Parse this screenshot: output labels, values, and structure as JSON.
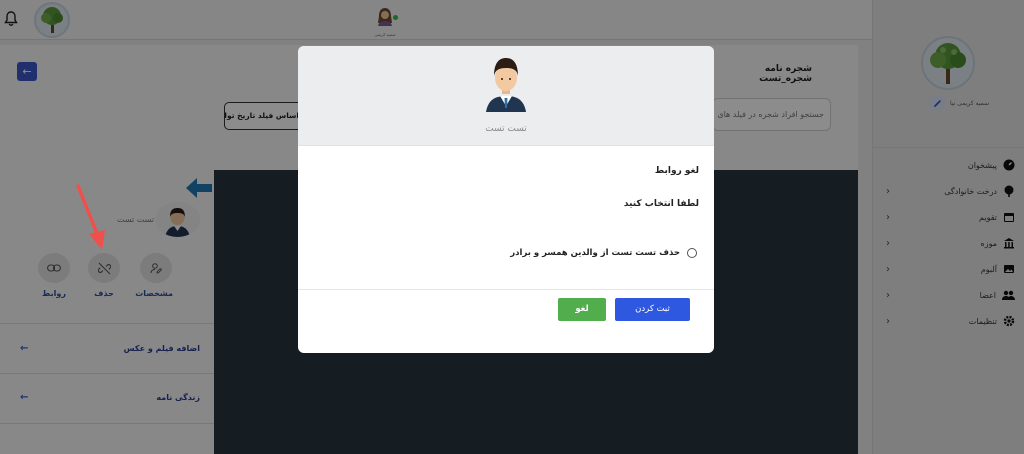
{
  "colors": {
    "accent": "#2f58e0",
    "cancel": "#52ad4c",
    "canvas": "#27353f",
    "arrow_annotation": "#f0504b"
  },
  "topbar": {
    "user_name": "صمیه کریمی"
  },
  "sidebar": {
    "user_name": "سمیه کریمی نیا",
    "items": [
      {
        "label": "پیشخوان",
        "icon": "dashboard-icon",
        "has_chevron": false
      },
      {
        "label": "درخت خانوادگی",
        "icon": "tree-icon",
        "has_chevron": true
      },
      {
        "label": "تقویم",
        "icon": "calendar-icon",
        "has_chevron": true
      },
      {
        "label": "موزه",
        "icon": "museum-icon",
        "has_chevron": true
      },
      {
        "label": "آلبوم",
        "icon": "album-icon",
        "has_chevron": true
      },
      {
        "label": "اعضا",
        "icon": "members-icon",
        "has_chevron": true
      },
      {
        "label": "تنظیمات",
        "icon": "settings-icon",
        "has_chevron": true
      }
    ]
  },
  "main": {
    "title": "شجره نامه شجره_تست",
    "search_placeholder": "جستجو افراد شجره در فیلد های",
    "filter_label": "اساس فیلد تاریخ تولد"
  },
  "node": {
    "name": "تست تست",
    "actions": [
      {
        "label": "مشخصات",
        "icon": "user-edit-icon"
      },
      {
        "label": "حذف",
        "icon": "unlink-icon"
      },
      {
        "label": "روابط",
        "icon": "link-icon"
      }
    ]
  },
  "left_panel": {
    "rows": [
      {
        "label": "اضافه فیلم و عکس"
      },
      {
        "label": "زندگی نامه"
      }
    ]
  },
  "modal": {
    "name": "تست تست",
    "title": "لغو روابط",
    "subtitle": "لطفا انتخاب کنید",
    "option": "حذف تست تست از والدین همسر و برادر",
    "submit_label": "ثبت کردن",
    "cancel_label": "لغو"
  }
}
